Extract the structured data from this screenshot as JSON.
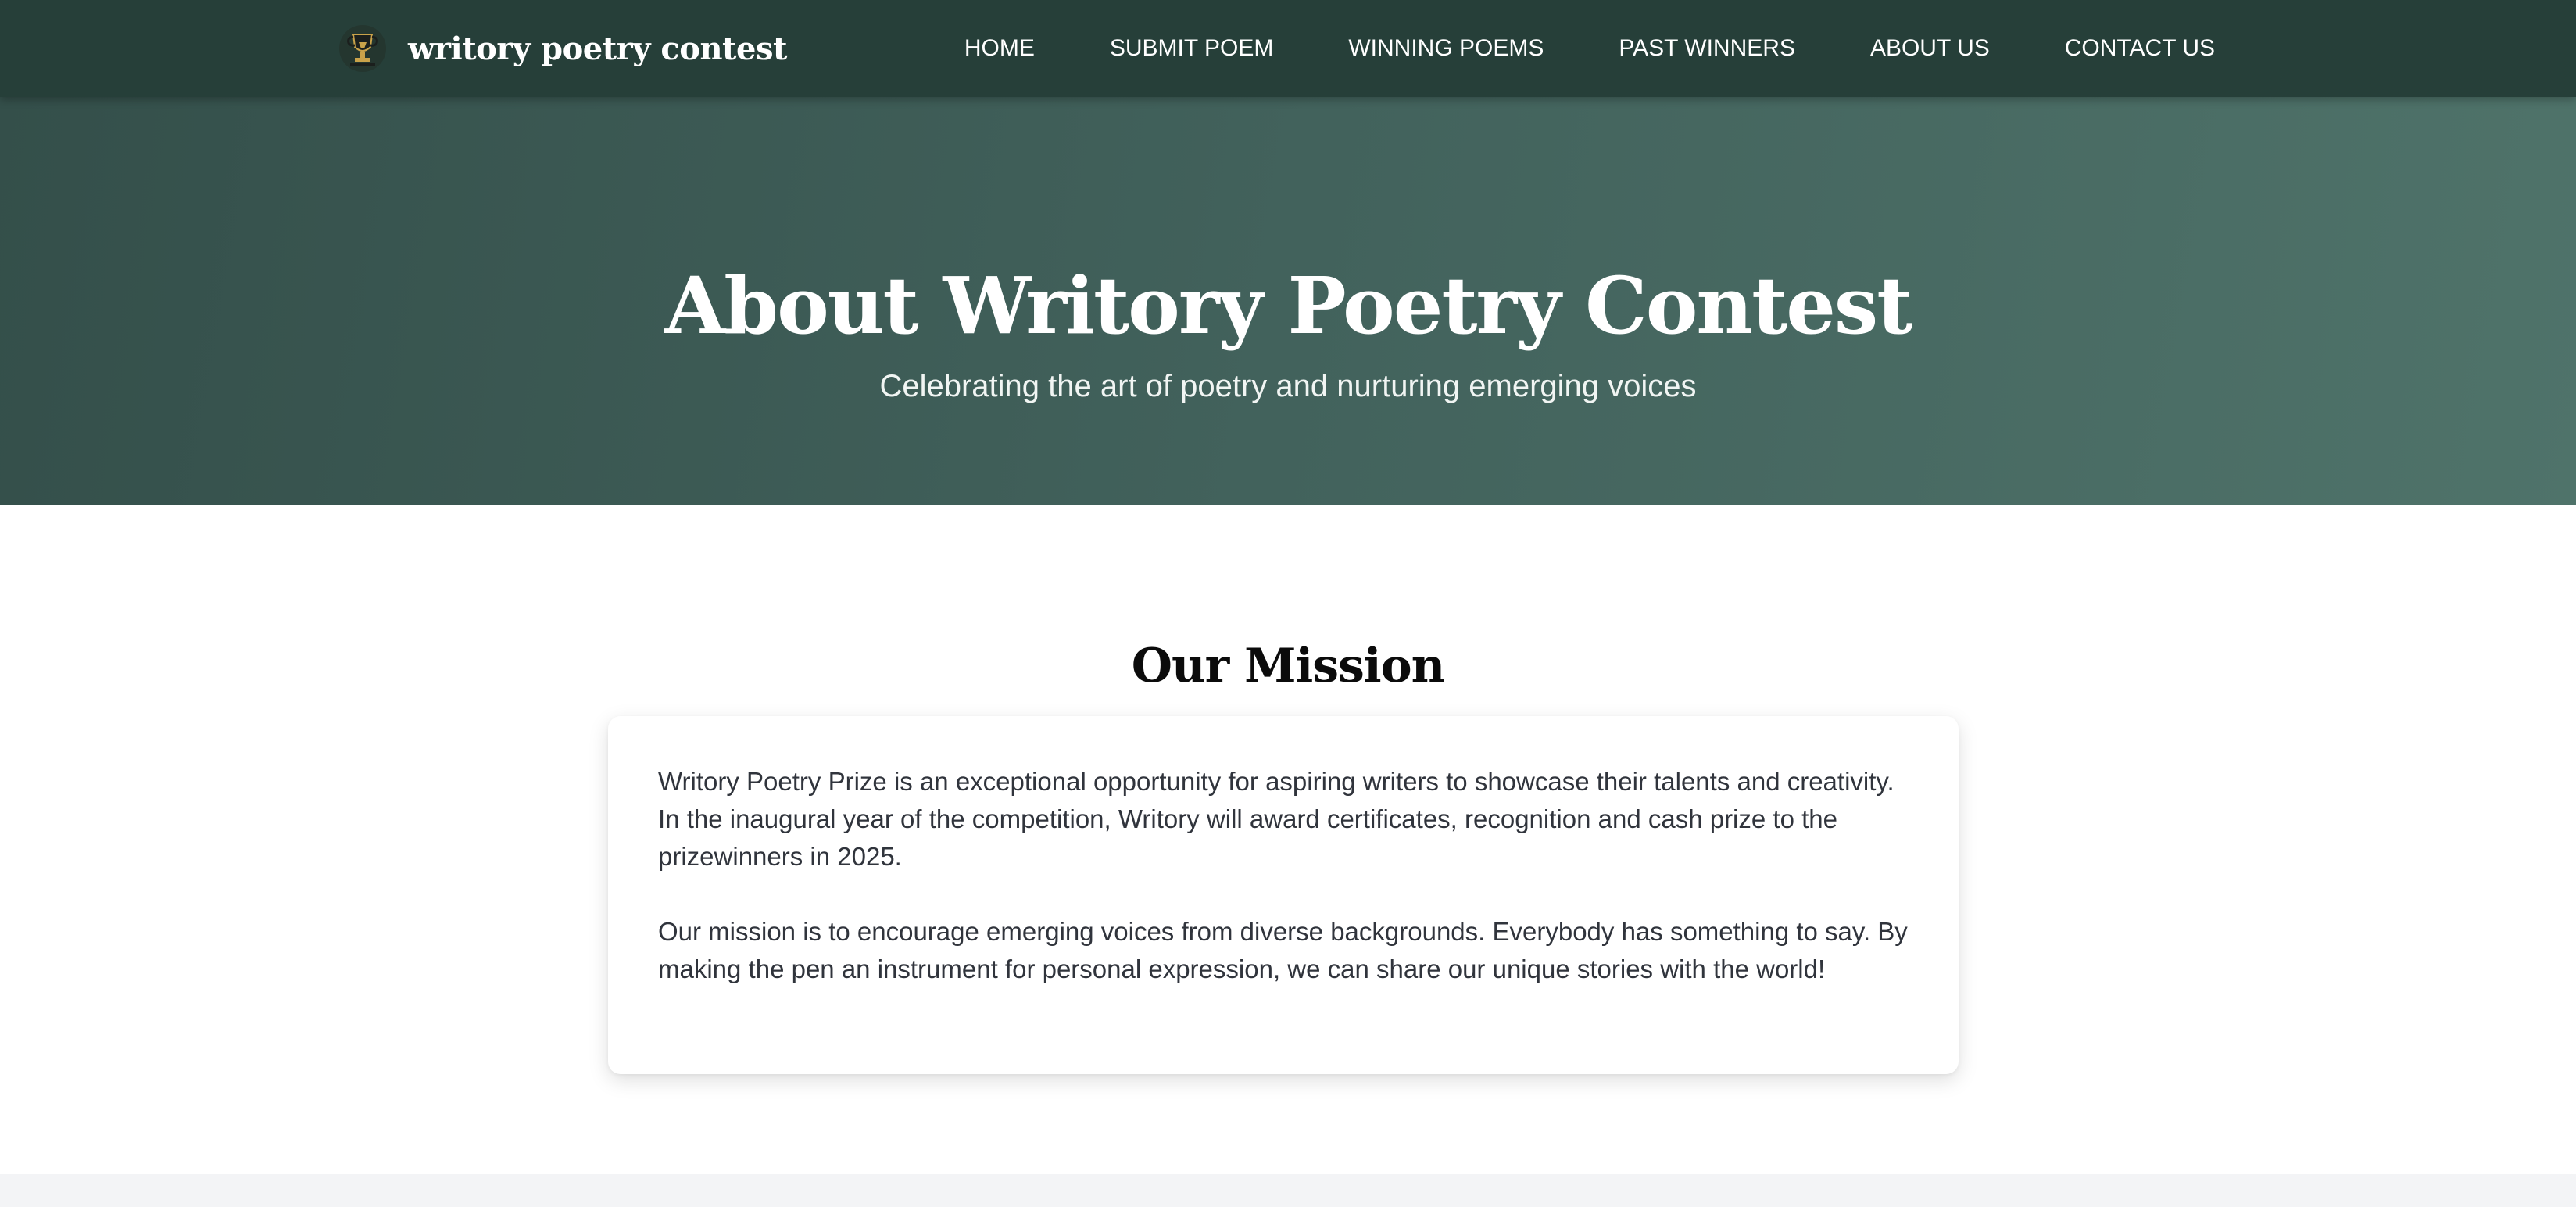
{
  "brand": {
    "name": "writory poetry contest",
    "logo_icon": "trophy-logo-icon",
    "logo_colors": {
      "dark": "#1b1f1d",
      "gold": "#c9a24a"
    }
  },
  "nav": {
    "items": [
      {
        "label": "HOME"
      },
      {
        "label": "SUBMIT POEM"
      },
      {
        "label": "WINNING POEMS"
      },
      {
        "label": "PAST WINNERS"
      },
      {
        "label": "ABOUT US"
      },
      {
        "label": "CONTACT US"
      }
    ]
  },
  "hero": {
    "title": "About Writory Poetry Contest",
    "subtitle": "Celebrating the art of poetry and nurturing emerging voices"
  },
  "mission": {
    "title": "Our Mission",
    "paragraphs": [
      "Writory Poetry Prize is an exceptional opportunity for aspiring writers to showcase their talents and creativity. In the inaugural year of the competition, Writory will award certificates, recognition and cash prize to the prizewinners in 2025.",
      "Our mission is to encourage emerging voices from diverse backgrounds. Everybody has something to say. By making the pen an instrument for personal expression, we can share our unique stories with the world!"
    ]
  },
  "colors": {
    "nav_bg": "#263f39",
    "hero_gradient_start": "#344f4a",
    "hero_gradient_end": "#4f736a",
    "text_dark": "#30343c",
    "footer_strip": "#f3f4f6"
  }
}
